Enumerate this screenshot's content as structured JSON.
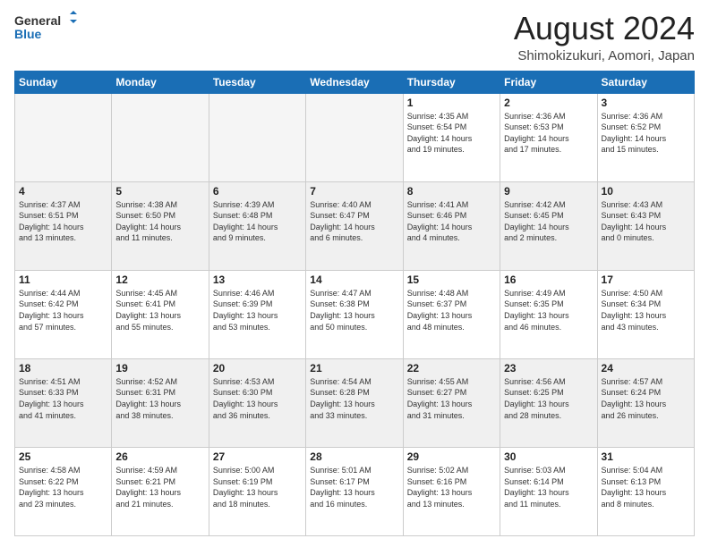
{
  "header": {
    "logo_line1": "General",
    "logo_line2": "Blue",
    "title": "August 2024",
    "subtitle": "Shimokizukuri, Aomori, Japan"
  },
  "days_of_week": [
    "Sunday",
    "Monday",
    "Tuesday",
    "Wednesday",
    "Thursday",
    "Friday",
    "Saturday"
  ],
  "weeks": [
    [
      {
        "day": "",
        "info": ""
      },
      {
        "day": "",
        "info": ""
      },
      {
        "day": "",
        "info": ""
      },
      {
        "day": "",
        "info": ""
      },
      {
        "day": "1",
        "info": "Sunrise: 4:35 AM\nSunset: 6:54 PM\nDaylight: 14 hours\nand 19 minutes."
      },
      {
        "day": "2",
        "info": "Sunrise: 4:36 AM\nSunset: 6:53 PM\nDaylight: 14 hours\nand 17 minutes."
      },
      {
        "day": "3",
        "info": "Sunrise: 4:36 AM\nSunset: 6:52 PM\nDaylight: 14 hours\nand 15 minutes."
      }
    ],
    [
      {
        "day": "4",
        "info": "Sunrise: 4:37 AM\nSunset: 6:51 PM\nDaylight: 14 hours\nand 13 minutes."
      },
      {
        "day": "5",
        "info": "Sunrise: 4:38 AM\nSunset: 6:50 PM\nDaylight: 14 hours\nand 11 minutes."
      },
      {
        "day": "6",
        "info": "Sunrise: 4:39 AM\nSunset: 6:48 PM\nDaylight: 14 hours\nand 9 minutes."
      },
      {
        "day": "7",
        "info": "Sunrise: 4:40 AM\nSunset: 6:47 PM\nDaylight: 14 hours\nand 6 minutes."
      },
      {
        "day": "8",
        "info": "Sunrise: 4:41 AM\nSunset: 6:46 PM\nDaylight: 14 hours\nand 4 minutes."
      },
      {
        "day": "9",
        "info": "Sunrise: 4:42 AM\nSunset: 6:45 PM\nDaylight: 14 hours\nand 2 minutes."
      },
      {
        "day": "10",
        "info": "Sunrise: 4:43 AM\nSunset: 6:43 PM\nDaylight: 14 hours\nand 0 minutes."
      }
    ],
    [
      {
        "day": "11",
        "info": "Sunrise: 4:44 AM\nSunset: 6:42 PM\nDaylight: 13 hours\nand 57 minutes."
      },
      {
        "day": "12",
        "info": "Sunrise: 4:45 AM\nSunset: 6:41 PM\nDaylight: 13 hours\nand 55 minutes."
      },
      {
        "day": "13",
        "info": "Sunrise: 4:46 AM\nSunset: 6:39 PM\nDaylight: 13 hours\nand 53 minutes."
      },
      {
        "day": "14",
        "info": "Sunrise: 4:47 AM\nSunset: 6:38 PM\nDaylight: 13 hours\nand 50 minutes."
      },
      {
        "day": "15",
        "info": "Sunrise: 4:48 AM\nSunset: 6:37 PM\nDaylight: 13 hours\nand 48 minutes."
      },
      {
        "day": "16",
        "info": "Sunrise: 4:49 AM\nSunset: 6:35 PM\nDaylight: 13 hours\nand 46 minutes."
      },
      {
        "day": "17",
        "info": "Sunrise: 4:50 AM\nSunset: 6:34 PM\nDaylight: 13 hours\nand 43 minutes."
      }
    ],
    [
      {
        "day": "18",
        "info": "Sunrise: 4:51 AM\nSunset: 6:33 PM\nDaylight: 13 hours\nand 41 minutes."
      },
      {
        "day": "19",
        "info": "Sunrise: 4:52 AM\nSunset: 6:31 PM\nDaylight: 13 hours\nand 38 minutes."
      },
      {
        "day": "20",
        "info": "Sunrise: 4:53 AM\nSunset: 6:30 PM\nDaylight: 13 hours\nand 36 minutes."
      },
      {
        "day": "21",
        "info": "Sunrise: 4:54 AM\nSunset: 6:28 PM\nDaylight: 13 hours\nand 33 minutes."
      },
      {
        "day": "22",
        "info": "Sunrise: 4:55 AM\nSunset: 6:27 PM\nDaylight: 13 hours\nand 31 minutes."
      },
      {
        "day": "23",
        "info": "Sunrise: 4:56 AM\nSunset: 6:25 PM\nDaylight: 13 hours\nand 28 minutes."
      },
      {
        "day": "24",
        "info": "Sunrise: 4:57 AM\nSunset: 6:24 PM\nDaylight: 13 hours\nand 26 minutes."
      }
    ],
    [
      {
        "day": "25",
        "info": "Sunrise: 4:58 AM\nSunset: 6:22 PM\nDaylight: 13 hours\nand 23 minutes."
      },
      {
        "day": "26",
        "info": "Sunrise: 4:59 AM\nSunset: 6:21 PM\nDaylight: 13 hours\nand 21 minutes."
      },
      {
        "day": "27",
        "info": "Sunrise: 5:00 AM\nSunset: 6:19 PM\nDaylight: 13 hours\nand 18 minutes."
      },
      {
        "day": "28",
        "info": "Sunrise: 5:01 AM\nSunset: 6:17 PM\nDaylight: 13 hours\nand 16 minutes."
      },
      {
        "day": "29",
        "info": "Sunrise: 5:02 AM\nSunset: 6:16 PM\nDaylight: 13 hours\nand 13 minutes."
      },
      {
        "day": "30",
        "info": "Sunrise: 5:03 AM\nSunset: 6:14 PM\nDaylight: 13 hours\nand 11 minutes."
      },
      {
        "day": "31",
        "info": "Sunrise: 5:04 AM\nSunset: 6:13 PM\nDaylight: 13 hours\nand 8 minutes."
      }
    ]
  ]
}
